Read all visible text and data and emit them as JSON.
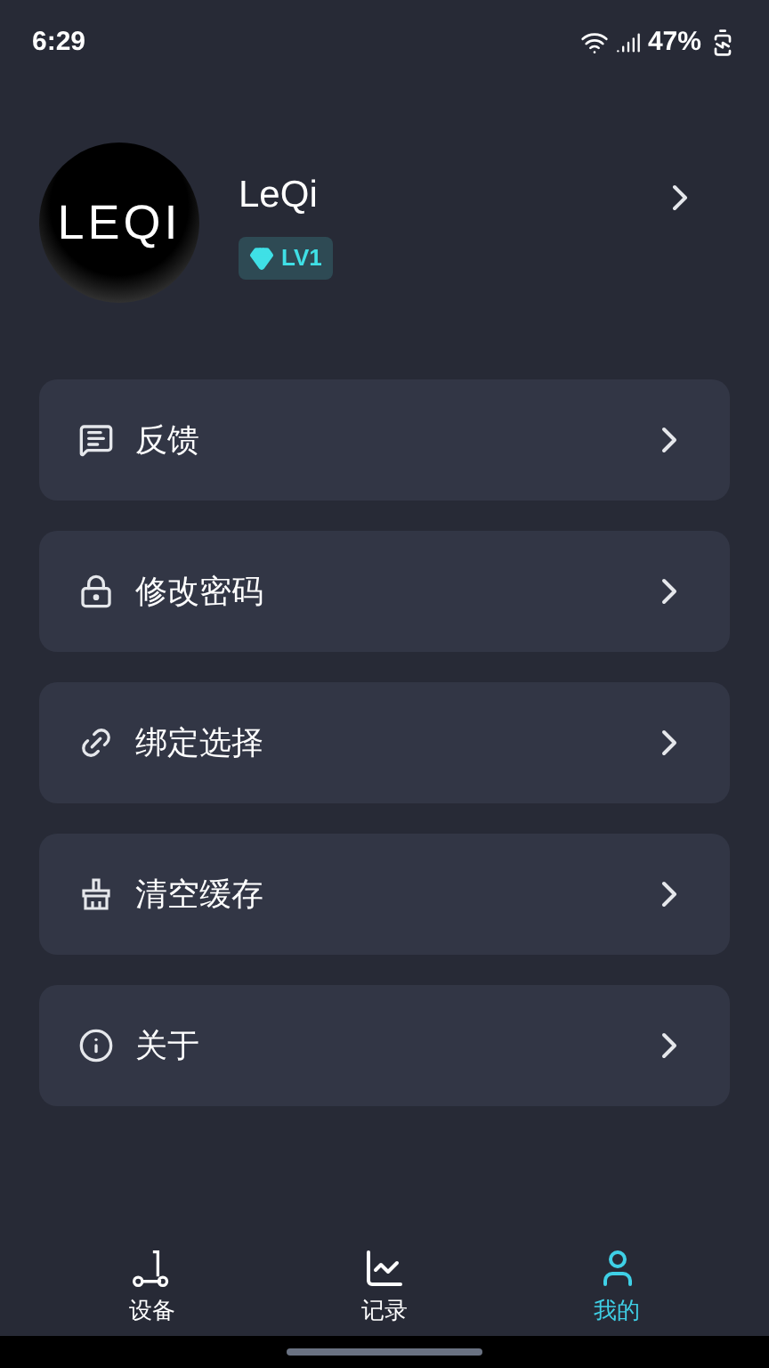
{
  "status_bar": {
    "time": "6:29",
    "battery": "47%"
  },
  "profile": {
    "avatar_text": "LEQI",
    "name": "LeQi",
    "level": "LV1"
  },
  "menu": [
    {
      "kind": "feedback",
      "label": "反馈"
    },
    {
      "kind": "lock",
      "label": "修改密码"
    },
    {
      "kind": "link",
      "label": "绑定选择"
    },
    {
      "kind": "broom",
      "label": "清空缓存"
    },
    {
      "kind": "info",
      "label": "关于"
    }
  ],
  "nav": [
    {
      "kind": "scooter",
      "label": "设备",
      "selected": false
    },
    {
      "kind": "chart",
      "label": "记录",
      "selected": false
    },
    {
      "kind": "user",
      "label": "我的",
      "selected": true
    }
  ]
}
